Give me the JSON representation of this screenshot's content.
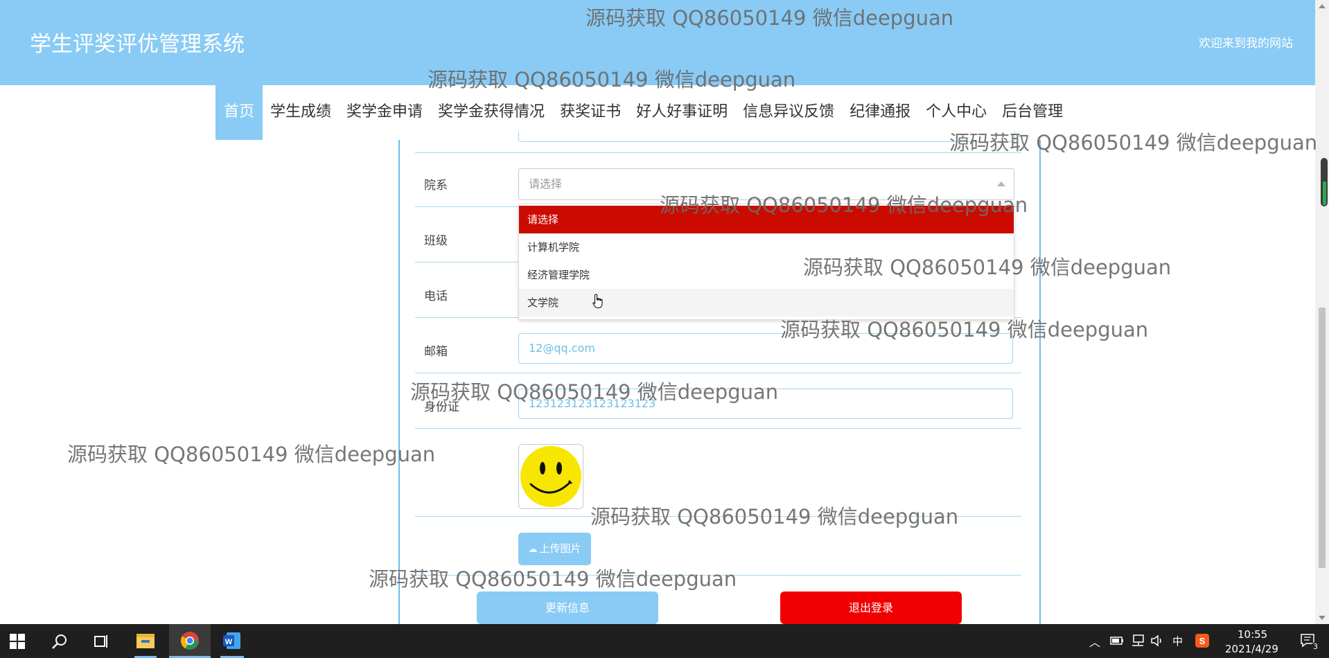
{
  "header": {
    "title": "学生评奖评优管理系统",
    "welcome": "欢迎来到我的网站"
  },
  "nav": {
    "items": [
      {
        "label": "首页"
      },
      {
        "label": "学生成绩"
      },
      {
        "label": "奖学金申请"
      },
      {
        "label": "奖学金获得情况"
      },
      {
        "label": "获奖证书"
      },
      {
        "label": "好人好事证明"
      },
      {
        "label": "信息异议反馈"
      },
      {
        "label": "纪律通报"
      },
      {
        "label": "个人中心"
      },
      {
        "label": "后台管理"
      }
    ],
    "active": "首页"
  },
  "form": {
    "department": {
      "label": "院系",
      "placeholder": "请选择",
      "options": [
        "请选择",
        "计算机学院",
        "经济管理学院",
        "文学院"
      ],
      "highlighted": "请选择",
      "hovered": "文学院"
    },
    "class_label": "班级",
    "phone_label": "电话",
    "email": {
      "label": "邮箱",
      "value": "12@qq.com"
    },
    "id_card": {
      "label": "身份证",
      "value": "123123123123123123"
    },
    "avatar_icon": "smiley-face-icon",
    "upload_button": "上传图片",
    "update_button": "更新信息",
    "logout_button": "退出登录"
  },
  "colors": {
    "header_bg": "#89cbf5",
    "selected_option": "#cc0b00",
    "logout": "#f00000",
    "panel_border": "#6cbfe8"
  },
  "watermarks": [
    "源码获取 QQ86050149 微信deepguan",
    "源码获取 QQ86050149 微信deepguan",
    "源码获取 QQ86050149 微信deepguan",
    "源码获取 QQ86050149 微信deepguan",
    "源码获取 QQ86050149 微信deepguan",
    "源码获取 QQ86050149 微信deepguan",
    "源码获取 QQ86050149 微信deepguan",
    "源码获取 QQ86050149 微信deepguan",
    "源码获取 QQ86050149 微信deepguan",
    "源码获取 QQ86050149 微信deepguan"
  ],
  "taskbar": {
    "apps": [
      "windows-start-icon",
      "search-icon",
      "task-view-icon",
      "file-explorer-icon",
      "chrome-icon",
      "word-icon"
    ],
    "tray": {
      "ime": "中",
      "time": "10:55",
      "date": "2021/4/29",
      "notifications": "3"
    }
  }
}
